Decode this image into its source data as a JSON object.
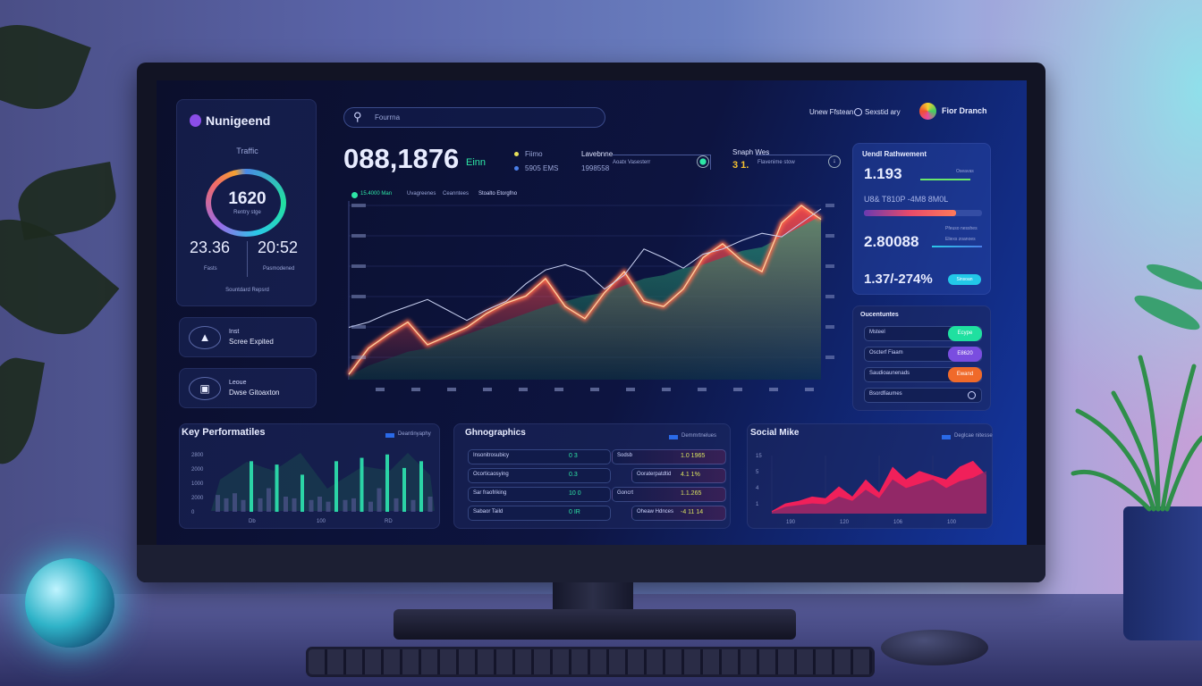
{
  "app": {
    "brand": "Nunigeend",
    "header_links": [
      "Unew Ffstean",
      "Sexstid ary"
    ],
    "user": "Fior Dranch",
    "search_placeholder": "Fourrna"
  },
  "colors": {
    "accent_green": "#2ee6a6",
    "accent_red": "#ff4a5a",
    "accent_purple": "#7a4de0",
    "accent_orange": "#f06a2a",
    "accent_cyan": "#22c8e8"
  },
  "traffic": {
    "title": "Traffic",
    "value": "1620",
    "value_sub": "Rentry stge",
    "stats": [
      {
        "value": "23.36",
        "label": "Fasts"
      },
      {
        "value": "20:52",
        "label": "Pasmodened"
      }
    ],
    "footer": "Sountdard Repsrd"
  },
  "side_items": [
    {
      "icon": "upload-icon",
      "title": "Inst",
      "subtitle": "Scree Expited"
    },
    {
      "icon": "devices-icon",
      "title": "Leoue",
      "subtitle": "Dwse Gitoaxton"
    }
  ],
  "kpi": {
    "value": "088,1876",
    "unit": "Einn",
    "legend": [
      {
        "label": "Fiimo",
        "color": "#e8e05a"
      },
      {
        "label": "5905 EMS",
        "color": "#4a7ee8"
      }
    ],
    "field1": {
      "label": "Lavebnne",
      "value": "1998558",
      "hint": "Aoatx Vasesterr"
    },
    "field2": {
      "label": "Snaph Wes",
      "value": "3 1.",
      "hint": "Flavenime stow"
    }
  },
  "main_chart": {
    "legend": [
      "15.4000 Man",
      "Uvagreenes",
      "Ceanntees",
      "Stoalto Etorgfno"
    ],
    "line": [
      30,
      33,
      38,
      42,
      46,
      40,
      34,
      40,
      45,
      55,
      63,
      66,
      62,
      52,
      60,
      75,
      70,
      64,
      72,
      75,
      80,
      84,
      82,
      90,
      98
    ],
    "glow": [
      3,
      18,
      26,
      33,
      20,
      25,
      30,
      38,
      44,
      48,
      58,
      42,
      35,
      50,
      62,
      45,
      42,
      52,
      70,
      78,
      68,
      62,
      90,
      100,
      92
    ],
    "area": [
      2,
      8,
      12,
      16,
      18,
      22,
      26,
      30,
      34,
      38,
      42,
      45,
      48,
      50,
      54,
      58,
      60,
      64,
      66,
      70,
      74,
      76,
      82,
      88,
      94
    ]
  },
  "performance": {
    "title": "Uendl Rathwement",
    "metric1": "1.193",
    "label1": "Oseavas",
    "desc": "U8& T810P -4M8 8M0L",
    "bar_progress": 0.78,
    "label2": "Pfeuso nesshes",
    "metric2": "2.80088",
    "label3": "Eliexs zoanoes",
    "metric3": "1.37/-274%",
    "badge": "Sinsoan"
  },
  "opportunities": {
    "title": "Oucentuntes",
    "items": [
      {
        "label": "Msteel",
        "badge": "Ecype",
        "color": "#1fe0a0"
      },
      {
        "label": "Oscterf Fiaam",
        "badge": "E8620",
        "color": "#7a4de0"
      },
      {
        "label": "Saudioaunenads",
        "badge": "Ewand",
        "color": "#f06a2a"
      },
      {
        "label": "Bsordfiaumes",
        "badge": ""
      }
    ]
  },
  "key_perf": {
    "title": "Key Performatiles",
    "legend": "Deantinyaphy",
    "y_ticks": [
      "2800",
      "2000",
      "1000",
      "2000",
      "0"
    ],
    "x_ticks": [
      "Db",
      "100",
      "RD"
    ],
    "bars": [
      10,
      8,
      11,
      7,
      30,
      8,
      14,
      28,
      9,
      8,
      22,
      7,
      9,
      6,
      30,
      7,
      8,
      32,
      6,
      14,
      34,
      8,
      26,
      7,
      30,
      9
    ]
  },
  "demographics": {
    "title": "Ghnographics",
    "legend": "Demmrtnelues",
    "rows": [
      {
        "l": "Insonitrosubicy",
        "v": "0 3",
        "l2": "Sodsb",
        "v2": "1.0 1965"
      },
      {
        "l": "Ocorticaosying",
        "v": "0.3",
        "l2": "Ooraterpatdtid",
        "v2": "4.1 1%"
      },
      {
        "l": "Sar fraofriking",
        "v": "10 0",
        "l2": "Goncrt",
        "v2": "1.1.265"
      },
      {
        "l": "Sabaor Taild",
        "v": "0 IR",
        "l2": "Oheaw Hdnces",
        "v2": "-4 11 14"
      }
    ]
  },
  "social": {
    "title": "Social Mike",
    "legend": "Deglcae nitesse",
    "y_ticks": [
      "15",
      "5",
      "4",
      "1"
    ],
    "x_ticks": [
      "190",
      "120",
      "106",
      "100"
    ],
    "front": [
      3,
      12,
      15,
      20,
      18,
      32,
      20,
      40,
      25,
      55,
      40,
      50,
      45,
      40,
      55,
      62,
      45
    ],
    "back": [
      2,
      8,
      10,
      12,
      11,
      20,
      15,
      28,
      18,
      40,
      30,
      35,
      40,
      30,
      38,
      42,
      50
    ]
  }
}
